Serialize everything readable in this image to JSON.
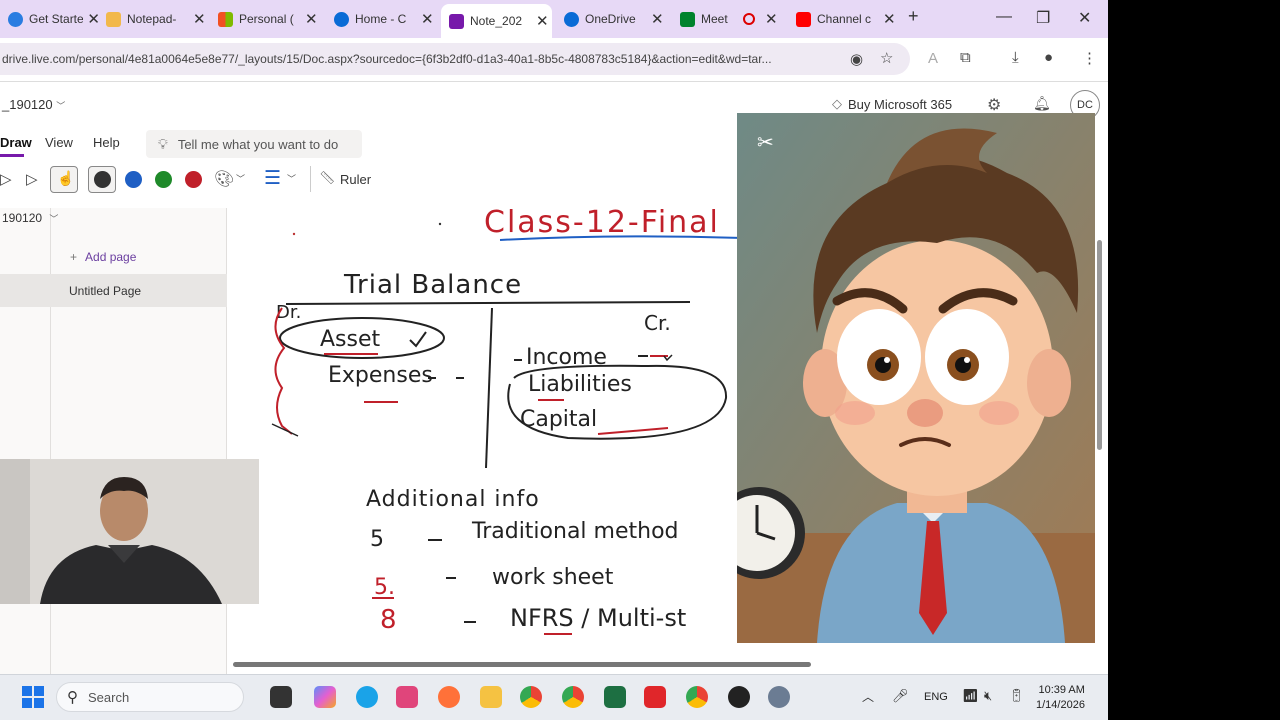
{
  "browser": {
    "tabs": [
      {
        "label": "Get Starte",
        "icon": "edge-icon",
        "color": "#2a7de1"
      },
      {
        "label": "Notepad-",
        "icon": "notepad-icon",
        "color": "#f2b84b"
      },
      {
        "label": "Personal (",
        "icon": "microsoft-icon",
        "color": "#f25022"
      },
      {
        "label": "Home - C",
        "icon": "onedrive-icon",
        "color": "#0a6bd6"
      },
      {
        "label": "Note_202",
        "icon": "onenote-icon",
        "color": "#7719aa"
      },
      {
        "label": "OneDrive",
        "icon": "onedrive-icon",
        "color": "#0a6bd6"
      },
      {
        "label": "Meet",
        "icon": "meet-icon",
        "color": "#00832d"
      },
      {
        "label": "Channel c",
        "icon": "youtube-icon",
        "color": "#ff0000"
      }
    ],
    "new_tab": "+",
    "url": "drive.live.com/personal/4e81a0064e5e8e77/_layouts/15/Doc.aspx?sourcedoc={6f3b2df0-d1a3-40a1-8b5c-4808783c5184}&action=edit&wd=tar..."
  },
  "onenote": {
    "notebook_title": "_190120",
    "buy_label": "Buy Microsoft 365",
    "avatar": "DC",
    "ribbon_tabs": [
      "Draw",
      "View",
      "Help"
    ],
    "tell_me": "Tell me what you want to do",
    "ruler_label": "Ruler",
    "pen_colors": [
      "#333333",
      "#1f5fc4",
      "#1f8a2a",
      "#c0202a"
    ],
    "section_title": "190120",
    "add_page": "Add page",
    "page_title": "Untitled Page"
  },
  "ink": {
    "title": "Class-12-Final",
    "heading": "Trial Balance",
    "dr": "Dr.",
    "cr": "Cr.",
    "debit_items": [
      "Asset",
      "Expenses"
    ],
    "credit_items": [
      "Income",
      "Liabilities",
      "Capital"
    ],
    "additional": "Additional info",
    "methods": [
      {
        "num": "5",
        "label": "Traditional method"
      },
      {
        "num": "5.",
        "label": "work sheet"
      },
      {
        "num": "8",
        "label": "NFRS / Multi-st"
      }
    ]
  },
  "taskbar": {
    "search": "Search",
    "lang": "ENG",
    "time": "10:39 AM",
    "date": "1/14/2026"
  }
}
